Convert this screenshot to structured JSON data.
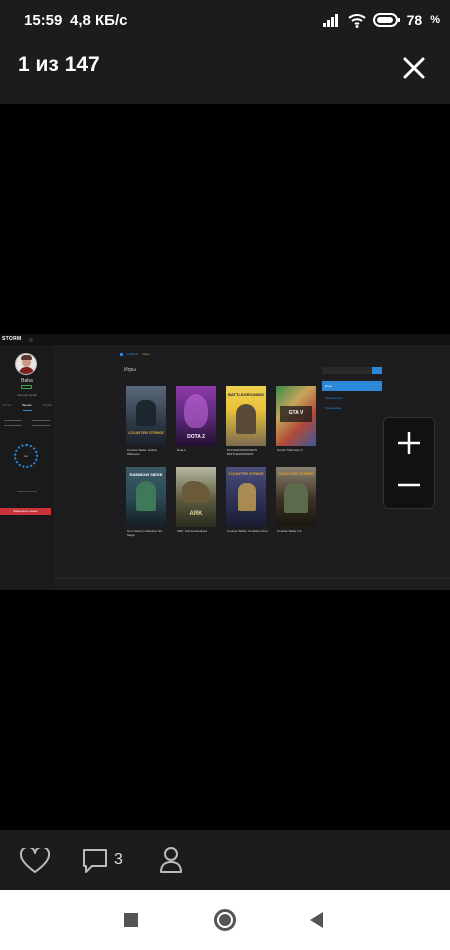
{
  "status_bar": {
    "time": "15:59",
    "network_speed": "4,8 КБ/с",
    "battery_level": "78",
    "battery_unit": "%",
    "icons": [
      "signal-icon",
      "wifi-icon",
      "battery-icon"
    ]
  },
  "viewer": {
    "counter": "1 из 147",
    "close_icon": "close-icon",
    "zoom_in_icon": "plus-icon",
    "zoom_out_icon": "minus-icon"
  },
  "screenshot": {
    "brand": "STORM",
    "user_name": "Baha",
    "tariff": "Чистый тариф",
    "sidebar_tabs": [
      "Гостей",
      "Время",
      "Тариф"
    ],
    "ring_value": "Ан",
    "red_button": "Завершить сеанс",
    "breadcrumb": [
      "Главная",
      "Игры"
    ],
    "section_title": "Игры",
    "side_menu": [
      "Игры",
      "Приложения",
      "Программы"
    ],
    "games": [
      {
        "title": "Counter-Strike: Global Offensive",
        "cover_text": "COUNTER STRIKE",
        "color": "#2f3a47"
      },
      {
        "title": "Dota 2",
        "cover_text": "DOTA 2",
        "color": "#5b2a79"
      },
      {
        "title": "PLAYERUNKNOWN'S BATTLEGROUNDS",
        "cover_text": "BATTLEGROUNDS",
        "color": "#e8c23a"
      },
      {
        "title": "Grand Theft Auto V",
        "cover_text": "GTA V",
        "color": "#c6a55a"
      },
      {
        "title": "Tom Clancy's Rainbow Six Siege",
        "cover_text": "RAINBOW SIEGE",
        "color": "#2c4a55"
      },
      {
        "title": "ARK: Survival Evolved",
        "cover_text": "ARK",
        "color": "#5b5a40"
      },
      {
        "title": "Counter-Strike: Condition Zero",
        "cover_text": "COUNTER STRIKE",
        "color": "#30345a"
      },
      {
        "title": "Counter-Strike 1.6",
        "cover_text": "COUNTER STRIKE",
        "color": "#3a3020"
      }
    ]
  },
  "actions": {
    "like_icon": "heart-icon",
    "comment_icon": "comment-icon",
    "comment_count": "3",
    "profile_icon": "user-icon"
  },
  "navigation": {
    "icons": [
      "recent-apps-icon",
      "home-icon",
      "back-icon"
    ]
  }
}
